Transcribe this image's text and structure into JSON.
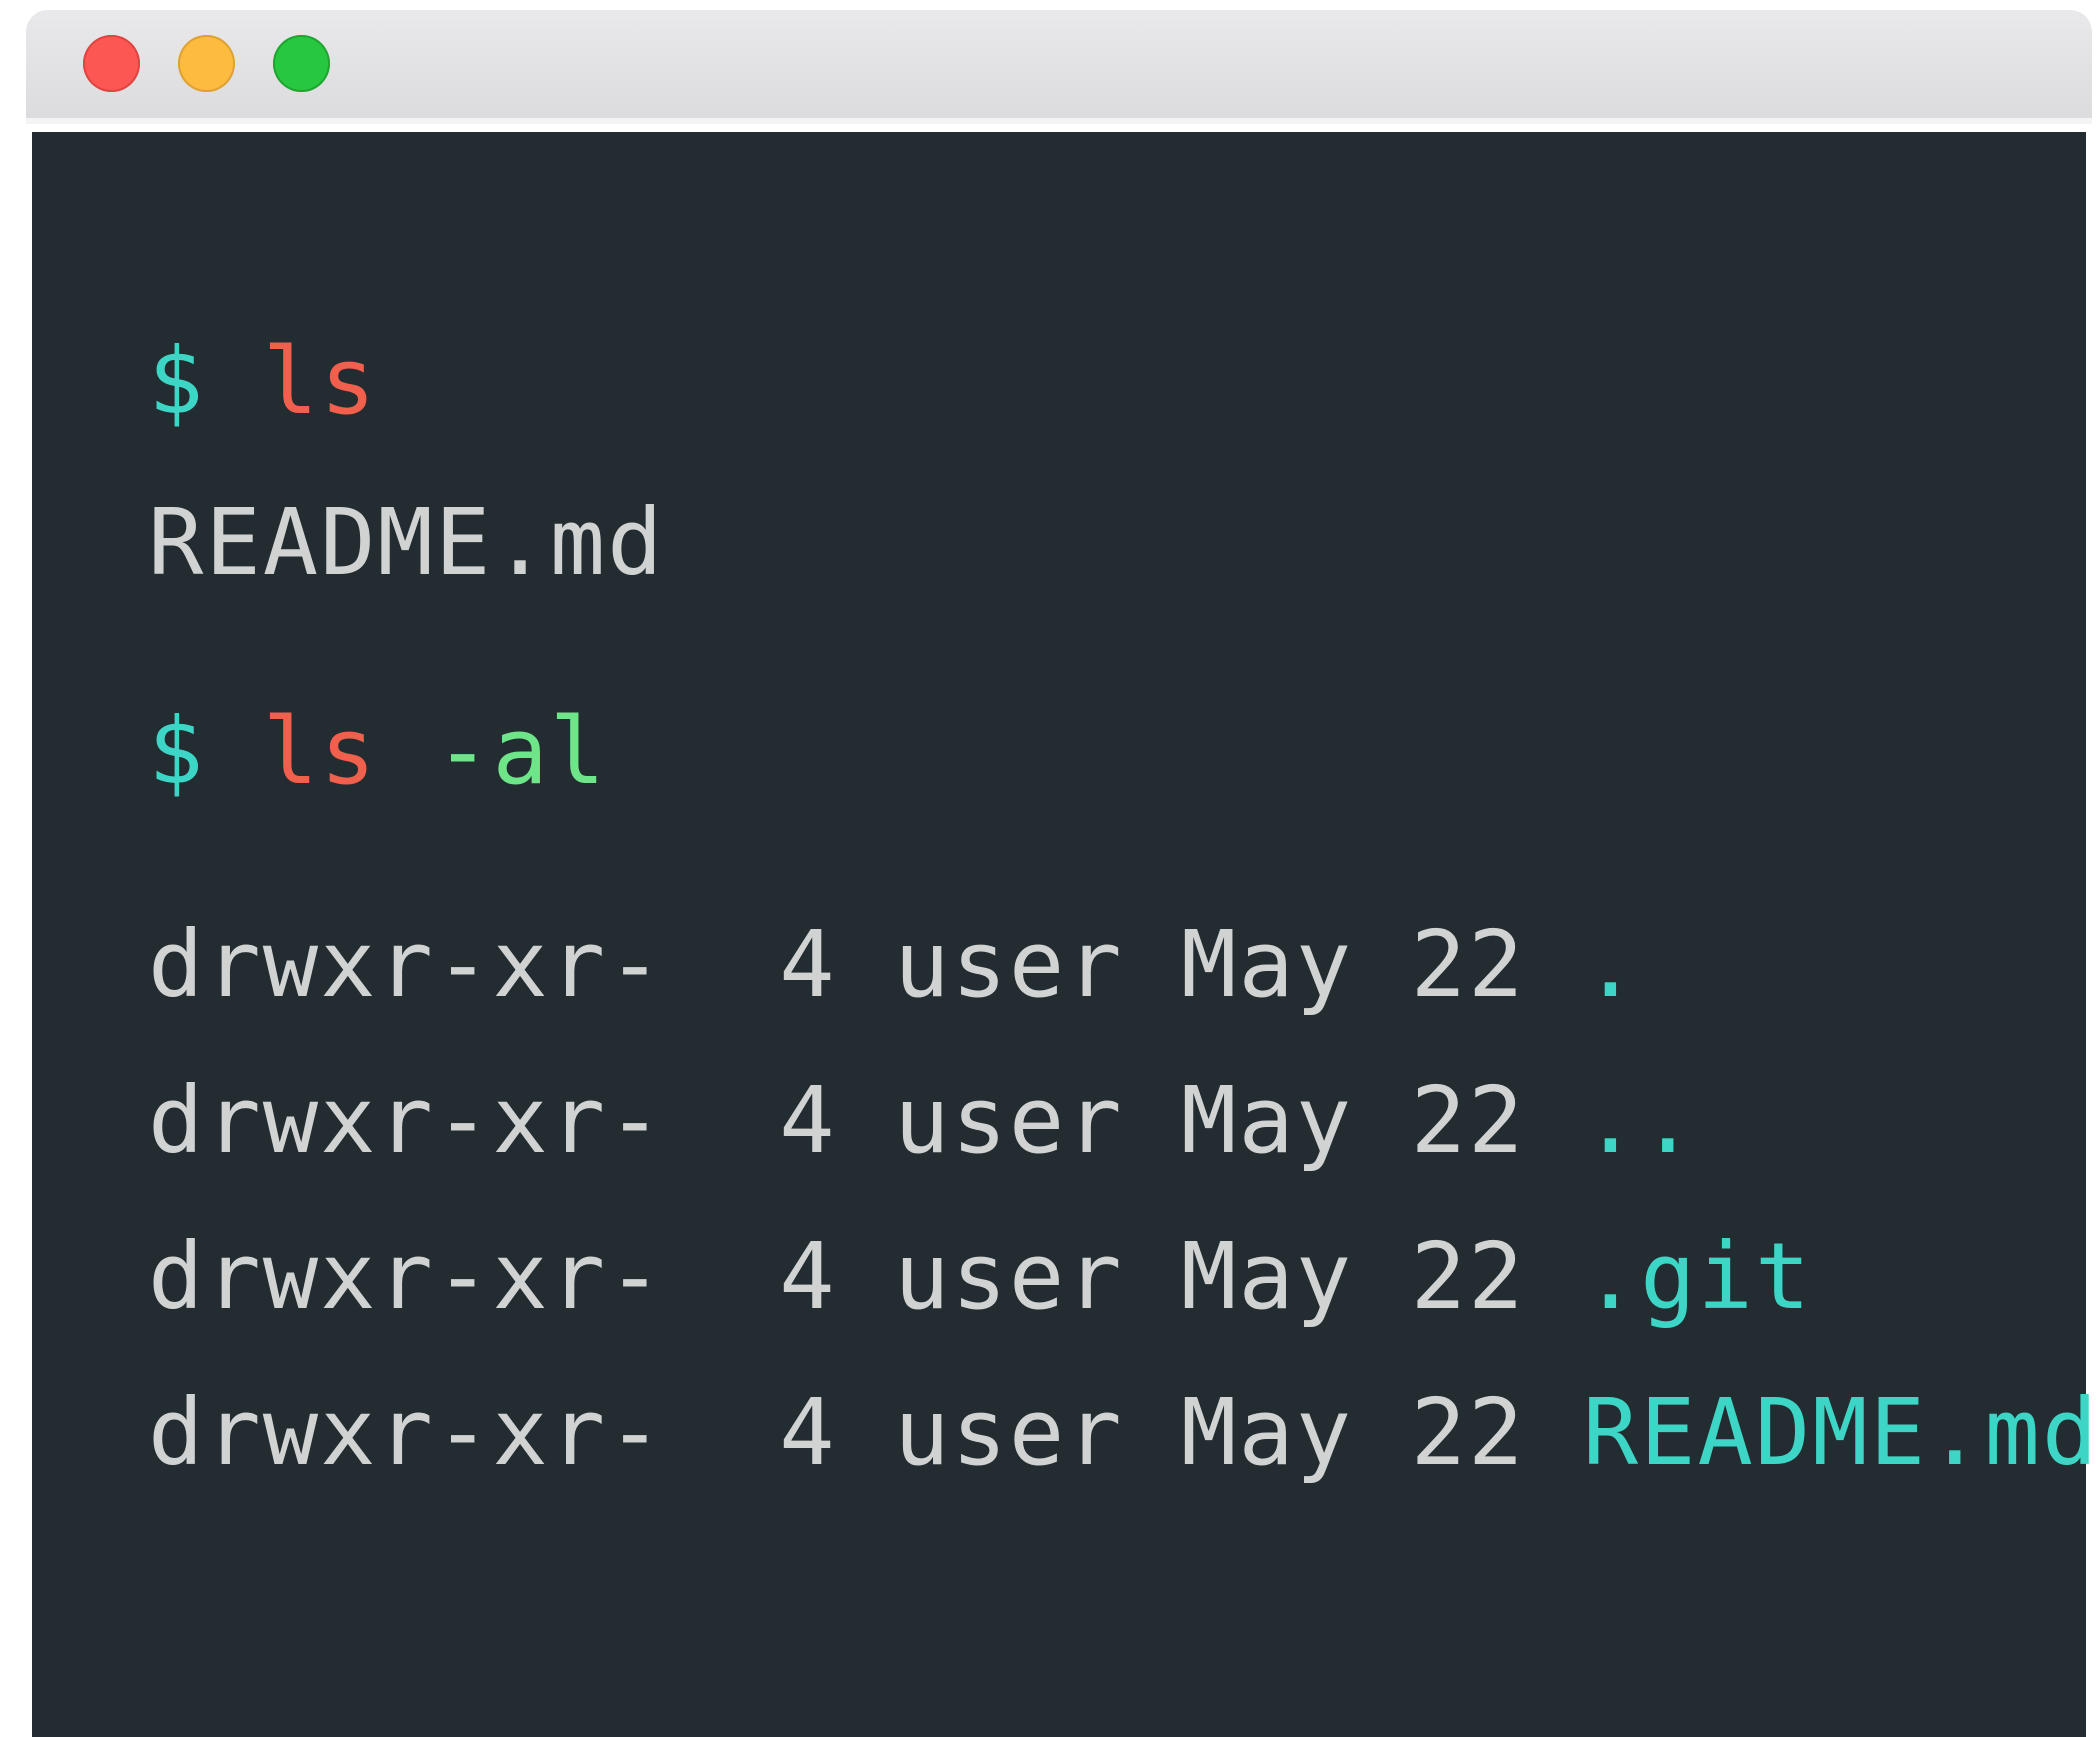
{
  "window": {
    "controls": [
      "close",
      "minimize",
      "maximize"
    ]
  },
  "colors": {
    "prompt": "#3dd6c6",
    "command": "#f0604d",
    "flag": "#6fe58a",
    "output": "#d1d3d2",
    "filename": "#3dd6c6",
    "background": "#232c31"
  },
  "session": {
    "first": {
      "prompt": "$",
      "command": "ls",
      "output": "README.md"
    },
    "second": {
      "prompt": "$",
      "command": "ls",
      "flag": "-al",
      "rows": [
        {
          "perms": "drwxr-xr-",
          "links": "4",
          "owner": "user",
          "month": "May",
          "day": "22",
          "name": "."
        },
        {
          "perms": "drwxr-xr-",
          "links": "4",
          "owner": "user",
          "month": "May",
          "day": "22",
          "name": ".."
        },
        {
          "perms": "drwxr-xr-",
          "links": "4",
          "owner": "user",
          "month": "May",
          "day": "22",
          "name": ".git"
        },
        {
          "perms": "drwxr-xr-",
          "links": "4",
          "owner": "user",
          "month": "May",
          "day": "22",
          "name": "README.md"
        }
      ]
    }
  }
}
